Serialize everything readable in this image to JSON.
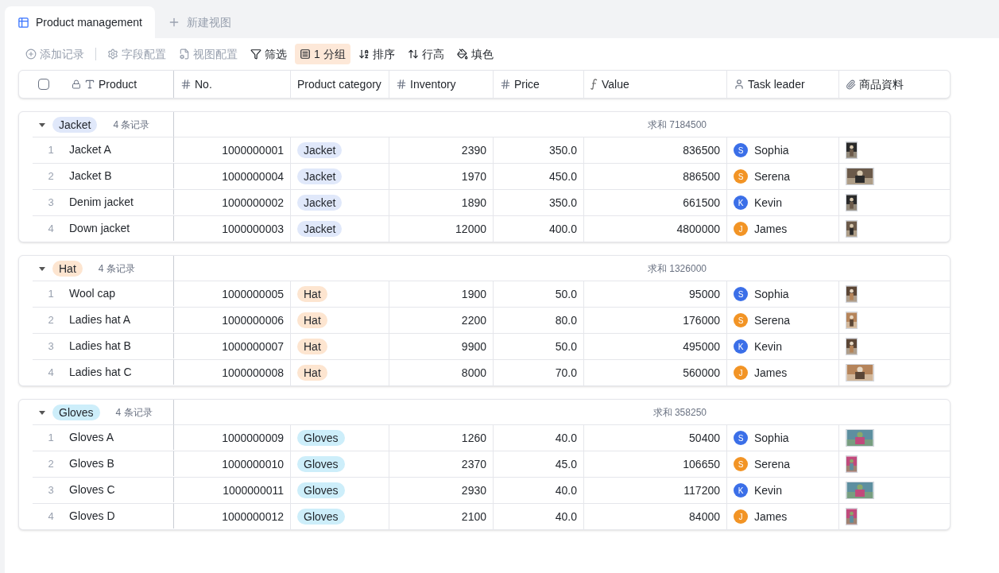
{
  "tabs": [
    {
      "label": "Product management",
      "selected": true
    },
    {
      "label": "新建视图",
      "selected": false
    }
  ],
  "toolbar": [
    {
      "label": "添加记录",
      "disabled": true,
      "selected": false
    },
    {
      "label": "字段配置",
      "disabled": true,
      "selected": false
    },
    {
      "label": "视图配置",
      "disabled": true,
      "selected": false
    },
    {
      "label": "筛选",
      "disabled": false,
      "selected": false
    },
    {
      "label": "1 分组",
      "disabled": false,
      "selected": true
    },
    {
      "label": "排序",
      "disabled": false,
      "selected": false
    },
    {
      "label": "行高",
      "disabled": false,
      "selected": false
    },
    {
      "label": "填色",
      "disabled": false,
      "selected": false
    }
  ],
  "table": {
    "select_all": {
      "checked": false
    },
    "columns": [
      {
        "label": "Product"
      },
      {
        "label": "No."
      },
      {
        "label": "Product category"
      },
      {
        "label": "Inventory"
      },
      {
        "label": "Price"
      },
      {
        "label": "Value"
      },
      {
        "label": "Task leader"
      },
      {
        "label": "商品資料"
      }
    ],
    "groups": [
      {
        "tag": "Jacket",
        "color": "#e0e8fa",
        "count": "4 条记录",
        "expanded": true,
        "sum": "求和 7184500",
        "rows": [
          {
            "index": "1",
            "product": "Jacket A",
            "no": "1000000001",
            "category": "Jacket",
            "inventory": "2390",
            "price": "350.0",
            "value": "836500",
            "leader": {
              "initial": "S",
              "name": "Sophia",
              "color": "#3b6fe8"
            }
          },
          {
            "index": "2",
            "product": "Jacket B",
            "no": "1000000004",
            "category": "Jacket",
            "inventory": "1970",
            "price": "450.0",
            "value": "886500",
            "leader": {
              "initial": "S",
              "name": "Serena",
              "color": "#f29425"
            }
          },
          {
            "index": "3",
            "product": "Denim jacket",
            "no": "1000000002",
            "category": "Jacket",
            "inventory": "1890",
            "price": "350.0",
            "value": "661500",
            "leader": {
              "initial": "K",
              "name": "Kevin",
              "color": "#3b6fe8"
            }
          },
          {
            "index": "4",
            "product": "Down jacket",
            "no": "1000000003",
            "category": "Jacket",
            "inventory": "12000",
            "price": "400.0",
            "value": "4800000",
            "leader": {
              "initial": "J",
              "name": "James",
              "color": "#f29425"
            }
          }
        ]
      },
      {
        "tag": "Hat",
        "color": "#fde5d0",
        "count": "4 条记录",
        "expanded": true,
        "sum": "求和 1326000",
        "rows": [
          {
            "index": "1",
            "product": "Wool cap",
            "no": "1000000005",
            "category": "Hat",
            "inventory": "1900",
            "price": "50.0",
            "value": "95000",
            "leader": {
              "initial": "S",
              "name": "Sophia",
              "color": "#3b6fe8"
            }
          },
          {
            "index": "2",
            "product": "Ladies hat A",
            "no": "1000000006",
            "category": "Hat",
            "inventory": "2200",
            "price": "80.0",
            "value": "176000",
            "leader": {
              "initial": "S",
              "name": "Serena",
              "color": "#f29425"
            }
          },
          {
            "index": "3",
            "product": "Ladies hat B",
            "no": "1000000007",
            "category": "Hat",
            "inventory": "9900",
            "price": "50.0",
            "value": "495000",
            "leader": {
              "initial": "K",
              "name": "Kevin",
              "color": "#3b6fe8"
            }
          },
          {
            "index": "4",
            "product": "Ladies hat C",
            "no": "1000000008",
            "category": "Hat",
            "inventory": "8000",
            "price": "70.0",
            "value": "560000",
            "leader": {
              "initial": "J",
              "name": "James",
              "color": "#f29425"
            }
          }
        ]
      },
      {
        "tag": "Gloves",
        "color": "#cdeefa",
        "count": "4 条记录",
        "expanded": true,
        "sum": "求和 358250",
        "rows": [
          {
            "index": "1",
            "product": "Gloves A",
            "no": "1000000009",
            "category": "Gloves",
            "inventory": "1260",
            "price": "40.0",
            "value": "50400",
            "leader": {
              "initial": "S",
              "name": "Sophia",
              "color": "#3b6fe8"
            }
          },
          {
            "index": "2",
            "product": "Gloves B",
            "no": "1000000010",
            "category": "Gloves",
            "inventory": "2370",
            "price": "45.0",
            "value": "106650",
            "leader": {
              "initial": "S",
              "name": "Serena",
              "color": "#f29425"
            }
          },
          {
            "index": "3",
            "product": "Gloves C",
            "no": "1000000011",
            "category": "Gloves",
            "inventory": "2930",
            "price": "40.0",
            "value": "117200",
            "leader": {
              "initial": "K",
              "name": "Kevin",
              "color": "#3b6fe8"
            }
          },
          {
            "index": "4",
            "product": "Gloves D",
            "no": "1000000012",
            "category": "Gloves",
            "inventory": "2100",
            "price": "40.0",
            "value": "84000",
            "leader": {
              "initial": "J",
              "name": "James",
              "color": "#f29425"
            }
          }
        ]
      }
    ]
  }
}
